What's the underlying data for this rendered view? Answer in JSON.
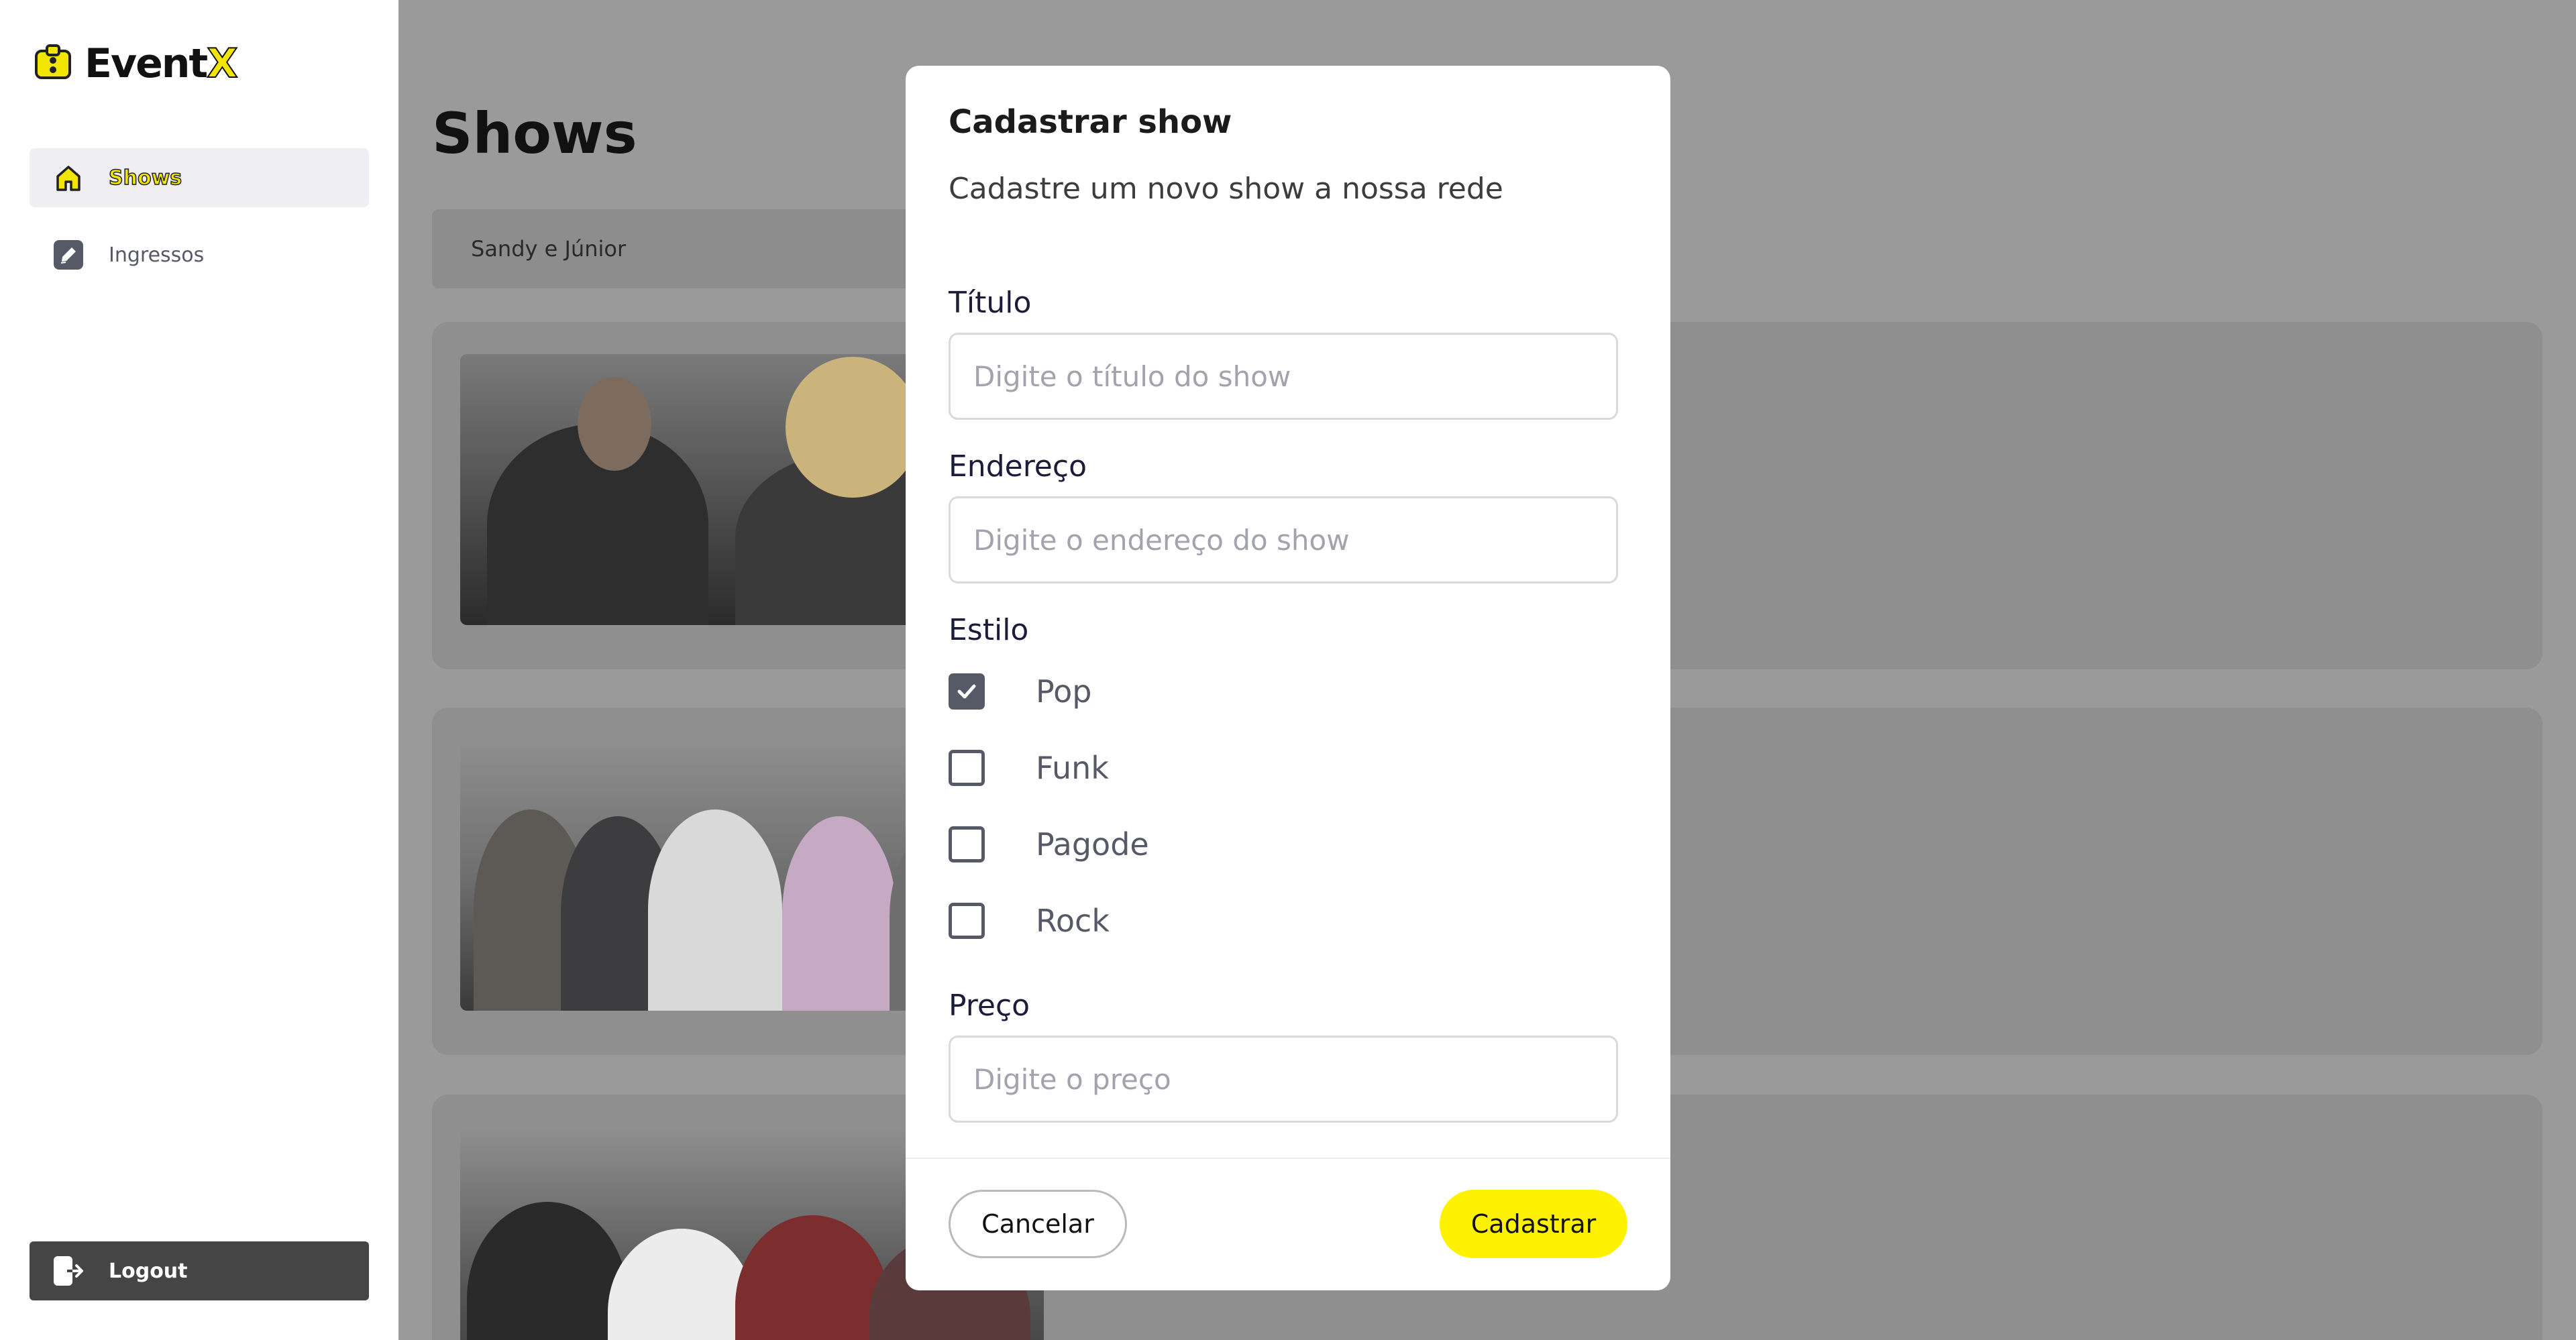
{
  "app": {
    "logo_text": "Event",
    "logo_accent": "X"
  },
  "sidebar": {
    "items": [
      {
        "label": "Shows",
        "icon": "home-icon",
        "active": true
      },
      {
        "label": "Ingressos",
        "icon": "edit-icon",
        "active": false
      }
    ],
    "logout_label": "Logout"
  },
  "main": {
    "title": "Shows",
    "search_value": "Sandy e Júnior"
  },
  "modal": {
    "title": "Cadastrar show",
    "subtitle": "Cadastre um novo show a nossa rede",
    "fields": {
      "titulo": {
        "label": "Título",
        "placeholder": "Digite o título do show",
        "value": ""
      },
      "endereco": {
        "label": "Endereço",
        "placeholder": "Digite o endereço do show",
        "value": ""
      },
      "preco": {
        "label": "Preço",
        "placeholder": "Digite o preço",
        "value": ""
      }
    },
    "estilo": {
      "label": "Estilo",
      "options": [
        {
          "label": "Pop",
          "checked": true
        },
        {
          "label": "Funk",
          "checked": false
        },
        {
          "label": "Pagode",
          "checked": false
        },
        {
          "label": "Rock",
          "checked": false
        }
      ]
    },
    "cancel_label": "Cancelar",
    "submit_label": "Cadastrar"
  },
  "colors": {
    "accent": "#fff200",
    "overlay": "#9a9a9a",
    "text_muted": "#555a66"
  }
}
